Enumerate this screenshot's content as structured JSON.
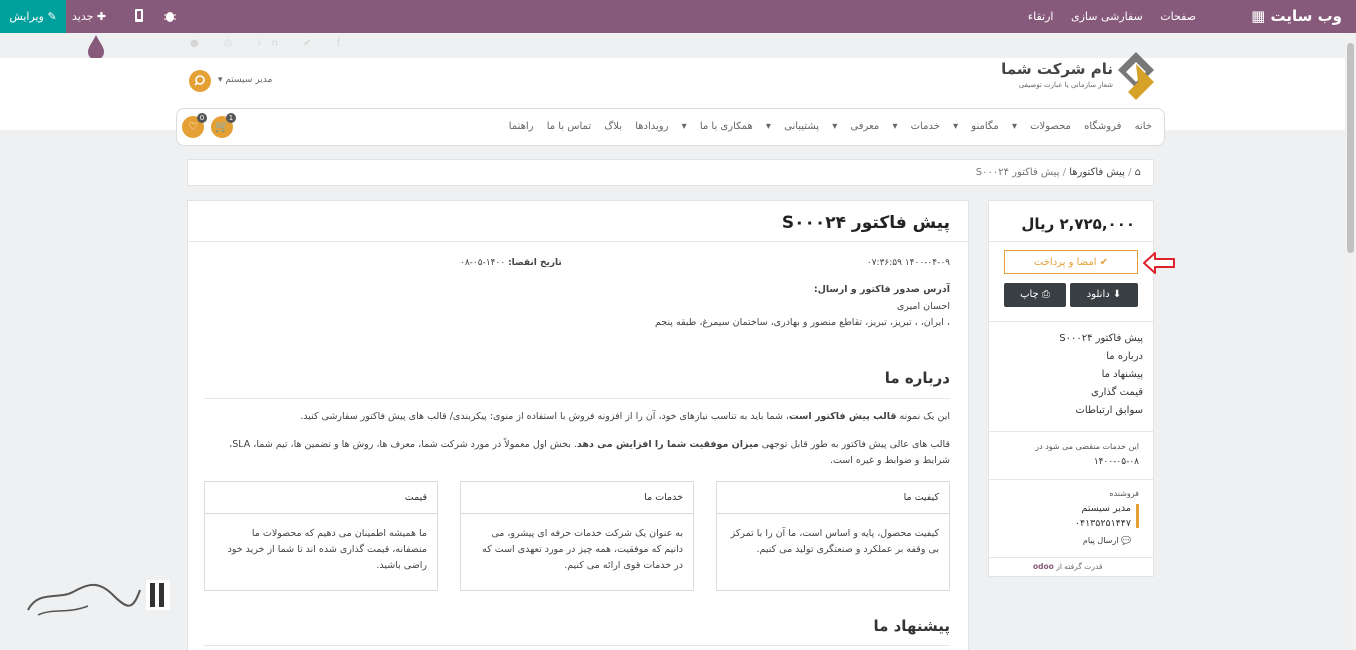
{
  "topbar": {
    "brand": "وب سایت",
    "menu": [
      "صفحات",
      "سفارشی سازی",
      "ارتقاء"
    ],
    "new_label": "جدید",
    "edit_label": "ویرایش"
  },
  "header": {
    "company_name": "نام شرکت شما",
    "company_slogan": "شعار سازمانی یا عبارت توصیفی",
    "user_name": "مدیر سیستم",
    "cart_count": "1",
    "wishlist_count": "0"
  },
  "nav": {
    "items": [
      "خانه",
      "فروشگاه",
      "محصولات",
      "مگامنو",
      "خدمات",
      "معرفی",
      "پشتیبانی",
      "همکاری با ما",
      "رویدادها",
      "بلاگ",
      "تماس با ما",
      "راهنما"
    ]
  },
  "breadcrumb": {
    "parent": "پیش فاکتورها",
    "current": "پیش فاکتور S۰۰۰۲۴"
  },
  "quote": {
    "title": "پیش فاکتور S۰۰۰۲۴",
    "date": "۱۴۰۰-۰۴-۰۹ ۰۷:۳۶:۵۹",
    "expiry_label": "تاریخ انقضا:",
    "expiry_value": "۱۴۰۰-۰۵-۰۸",
    "address_label": "آدرس صدور فاکتور و ارسال:",
    "customer": "احسان امیری",
    "address": "، ایران، ، تبریز، تبریز، تقاطع منصور و بهادری، ساختمان سیمرغ، طبقه پنجم"
  },
  "about": {
    "heading": "درباره ما",
    "p1_a": "این یک نمونه ",
    "p1_b": "قالب پیش فاکتور است",
    "p1_c": "، شما باید به تناسب نیازهای خود، آن را از افزونه فروش با استفاده از منوی: پیکربندی/ قالب های پیش فاکتور سفارشی کنید.",
    "p2_a": "قالب های عالی پیش فاکتور به طور قابل توجهی ",
    "p2_b": "میزان موفقیت شما را افزایش می دهد",
    "p2_c": ". بخش اول معمولاً در مورد شرکت شما، معرف ها، روش ها و تضمین ها، تیم شما، SLA، شرایط و ضوابط و غیره است."
  },
  "cards": [
    {
      "title": "کیفیت ما",
      "body": "کیفیت محصول، پایه و اساس است، ما آن را با تمرکز بی وقفه بر عملکرد و صنعتگری تولید می کنیم."
    },
    {
      "title": "خدمات ما",
      "body": "به عنوان یک شرکت خدمات حرفه ای پیشرو، می دانیم که موفقیت، همه چیز در مورد تعهدی است که در خدمات قوی ارائه می کنیم."
    },
    {
      "title": "قیمت",
      "body": "ما همیشه اطمینان می دهیم که محصولات ما منصفانه، قیمت گذاری شده اند تا شما از خرید خود راضی باشید."
    }
  ],
  "offer_heading": "پیشنهاد ما",
  "sidebar": {
    "amount": "۲,۷۲۵,۰۰۰ ریال",
    "sign_pay": "امضا و پرداخت",
    "download": "دانلود",
    "print": "چاپ",
    "links": [
      "پیش فاکتور S۰۰۰۲۴",
      "درباره ما",
      "پیشنهاد ما",
      "قیمت گذاری",
      "سوابق ارتباطات"
    ],
    "expiry_note": "این خدمات منقضی می شود در",
    "expiry_date": "۱۴۰۰-۰۵-۰۸",
    "seller_label": "فروشنده",
    "seller_name": "مدیر سیستم",
    "seller_phone": "۰۴۱۳۵۲۵۱۴۴۷",
    "send_message": "ارسال پیام",
    "powered_by": "قدرت گرفته از",
    "powered_brand": "odoo"
  },
  "colors": {
    "topbar": "#875a7b",
    "edit": "#00a09d",
    "accent": "#e4a035",
    "dark_button": "#3a3f44",
    "arrow": "#e0202a"
  }
}
